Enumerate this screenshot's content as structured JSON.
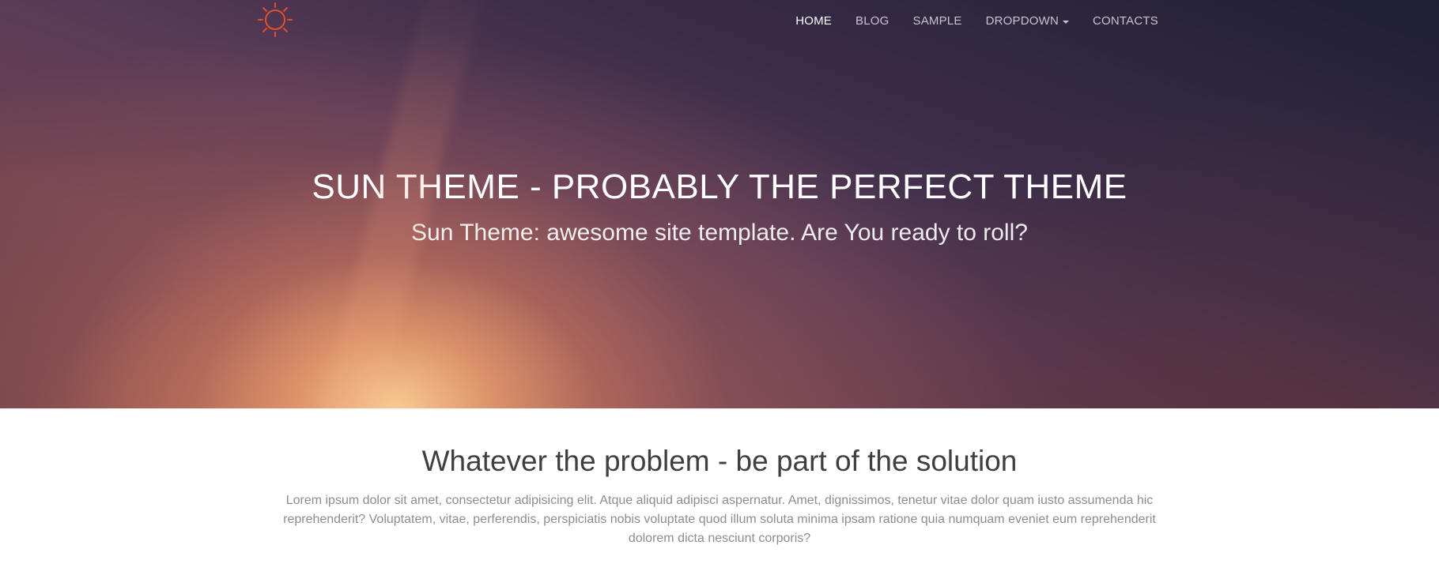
{
  "colors": {
    "accent": "#e2502b",
    "nav_text": "#e8e2e8",
    "heading_dark": "#3f3f3f",
    "body_text": "#8d8d8d"
  },
  "header": {
    "logo_icon": "sun-icon",
    "nav": [
      {
        "label": "HOME",
        "active": true
      },
      {
        "label": "BLOG",
        "active": false
      },
      {
        "label": "SAMPLE",
        "active": false
      },
      {
        "label": "DROPDOWN",
        "active": false,
        "dropdown": true
      },
      {
        "label": "CONTACTS",
        "active": false
      }
    ]
  },
  "hero": {
    "title": "SUN THEME - PROBABLY THE PERFECT THEME",
    "subtitle": "Sun Theme: awesome site template. Are You ready to roll?"
  },
  "content": {
    "title": "Whatever the problem - be part of the solution",
    "body": "Lorem ipsum dolor sit amet, consectetur adipisicing elit. Atque aliquid adipisci aspernatur. Amet, dignissimos, tenetur vitae dolor quam iusto assumenda hic reprehenderit? Voluptatem, vitae, perferendis, perspiciatis nobis voluptate quod illum soluta minima ipsam ratione quia numquam eveniet eum reprehenderit dolorem dicta nesciunt corporis?"
  }
}
